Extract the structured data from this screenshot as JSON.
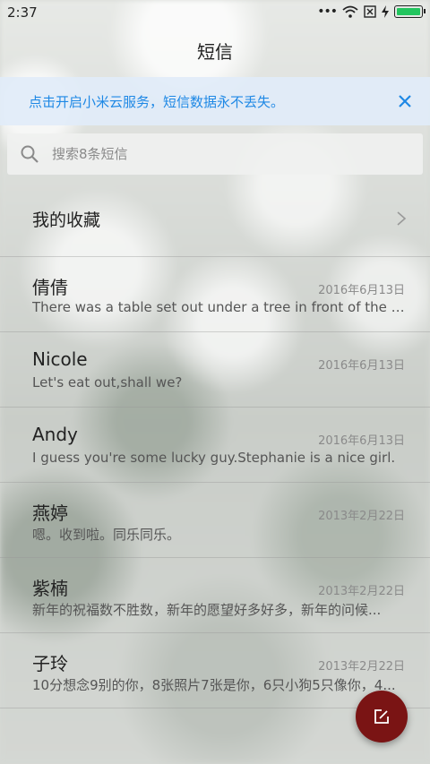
{
  "status_bar": {
    "time": "2:37",
    "icons": [
      "signal-dots-icon",
      "wifi-icon",
      "sim-x-icon",
      "charging-icon",
      "battery-icon"
    ],
    "battery_color": "#22c55e"
  },
  "header": {
    "title": "短信"
  },
  "banner": {
    "text": "点击开启小米云服务，短信数据永不丢失。",
    "color": "#1e88e5"
  },
  "search": {
    "placeholder": "搜索8条短信"
  },
  "favorites": {
    "label": "我的收藏"
  },
  "conversations": [
    {
      "name": "倩倩",
      "date": "2016年6月13日",
      "preview": "There was a table set out under a tree in front of the ho..."
    },
    {
      "name": "Nicole",
      "date": "2016年6月13日",
      "preview": "Let's eat out,shall we?"
    },
    {
      "name": "Andy",
      "date": "2016年6月13日",
      "preview": "I guess you're some lucky guy.Stephanie is a nice girl."
    },
    {
      "name": "燕婷",
      "date": "2013年2月22日",
      "preview": "嗯。收到啦。同乐同乐。"
    },
    {
      "name": "紫楠",
      "date": "2013年2月22日",
      "preview": "新年的祝福数不胜数，新年的愿望好多好多，新年的问候..."
    },
    {
      "name": "子玲",
      "date": "2013年2月22日",
      "preview": "10分想念9别的你，8张照片7张是你，6只小狗5只像你，4..."
    }
  ],
  "fab": {
    "icon": "compose-icon",
    "color": "#7a1414"
  }
}
